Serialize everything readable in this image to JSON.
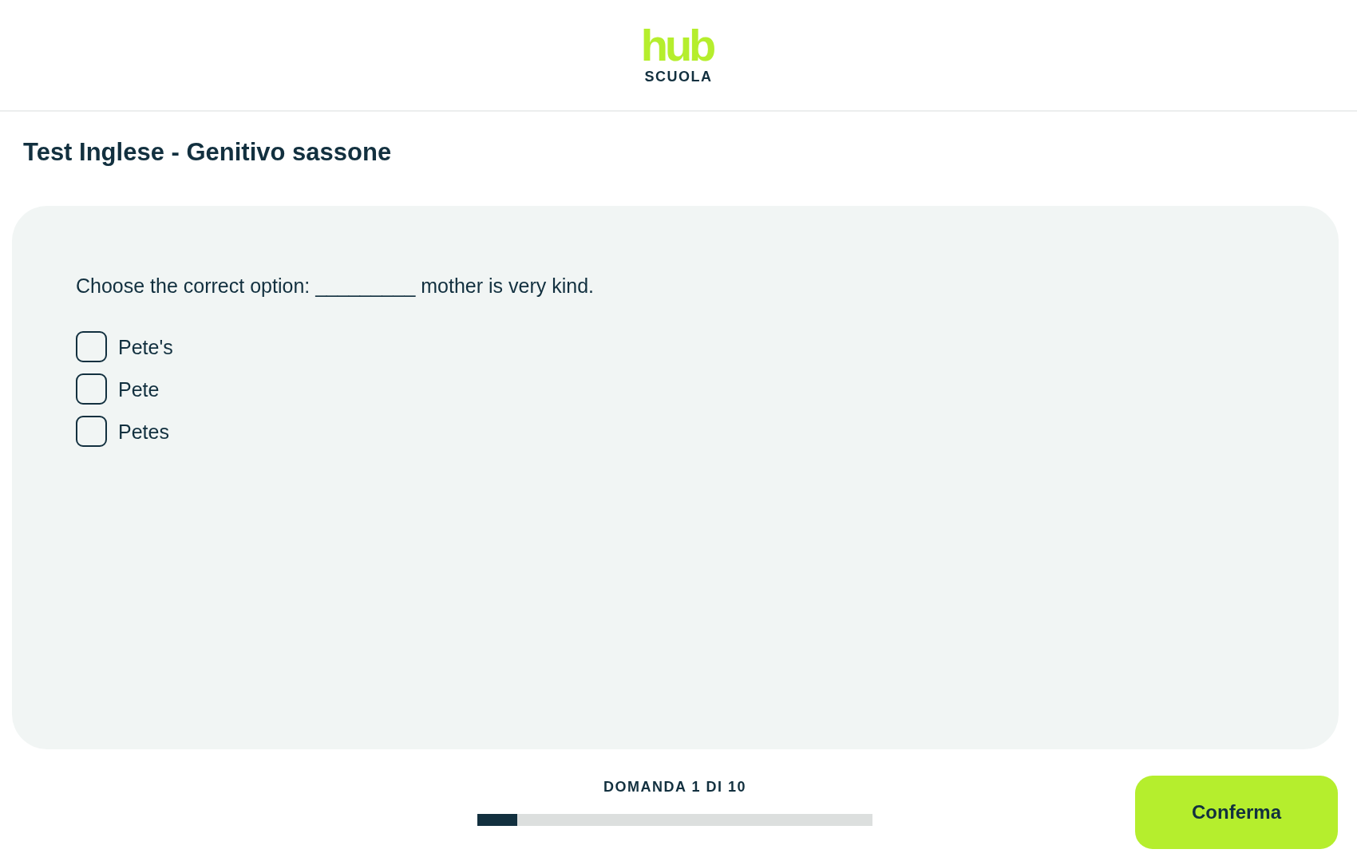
{
  "header": {
    "logo": {
      "wordmark": "hub",
      "tagline": "SCUOLA"
    }
  },
  "title": "Test Inglese - Genitivo sassone",
  "question": {
    "text": "Choose the correct option: _________ mother is very kind.",
    "options": [
      {
        "label": "Pete's",
        "checked": false
      },
      {
        "label": "Pete",
        "checked": false
      },
      {
        "label": "Petes",
        "checked": false
      }
    ]
  },
  "footer": {
    "progress": {
      "label": "DOMANDA 1 DI 10",
      "level": 0.1
    },
    "confirm_button": {
      "label": "Conferma"
    }
  }
}
